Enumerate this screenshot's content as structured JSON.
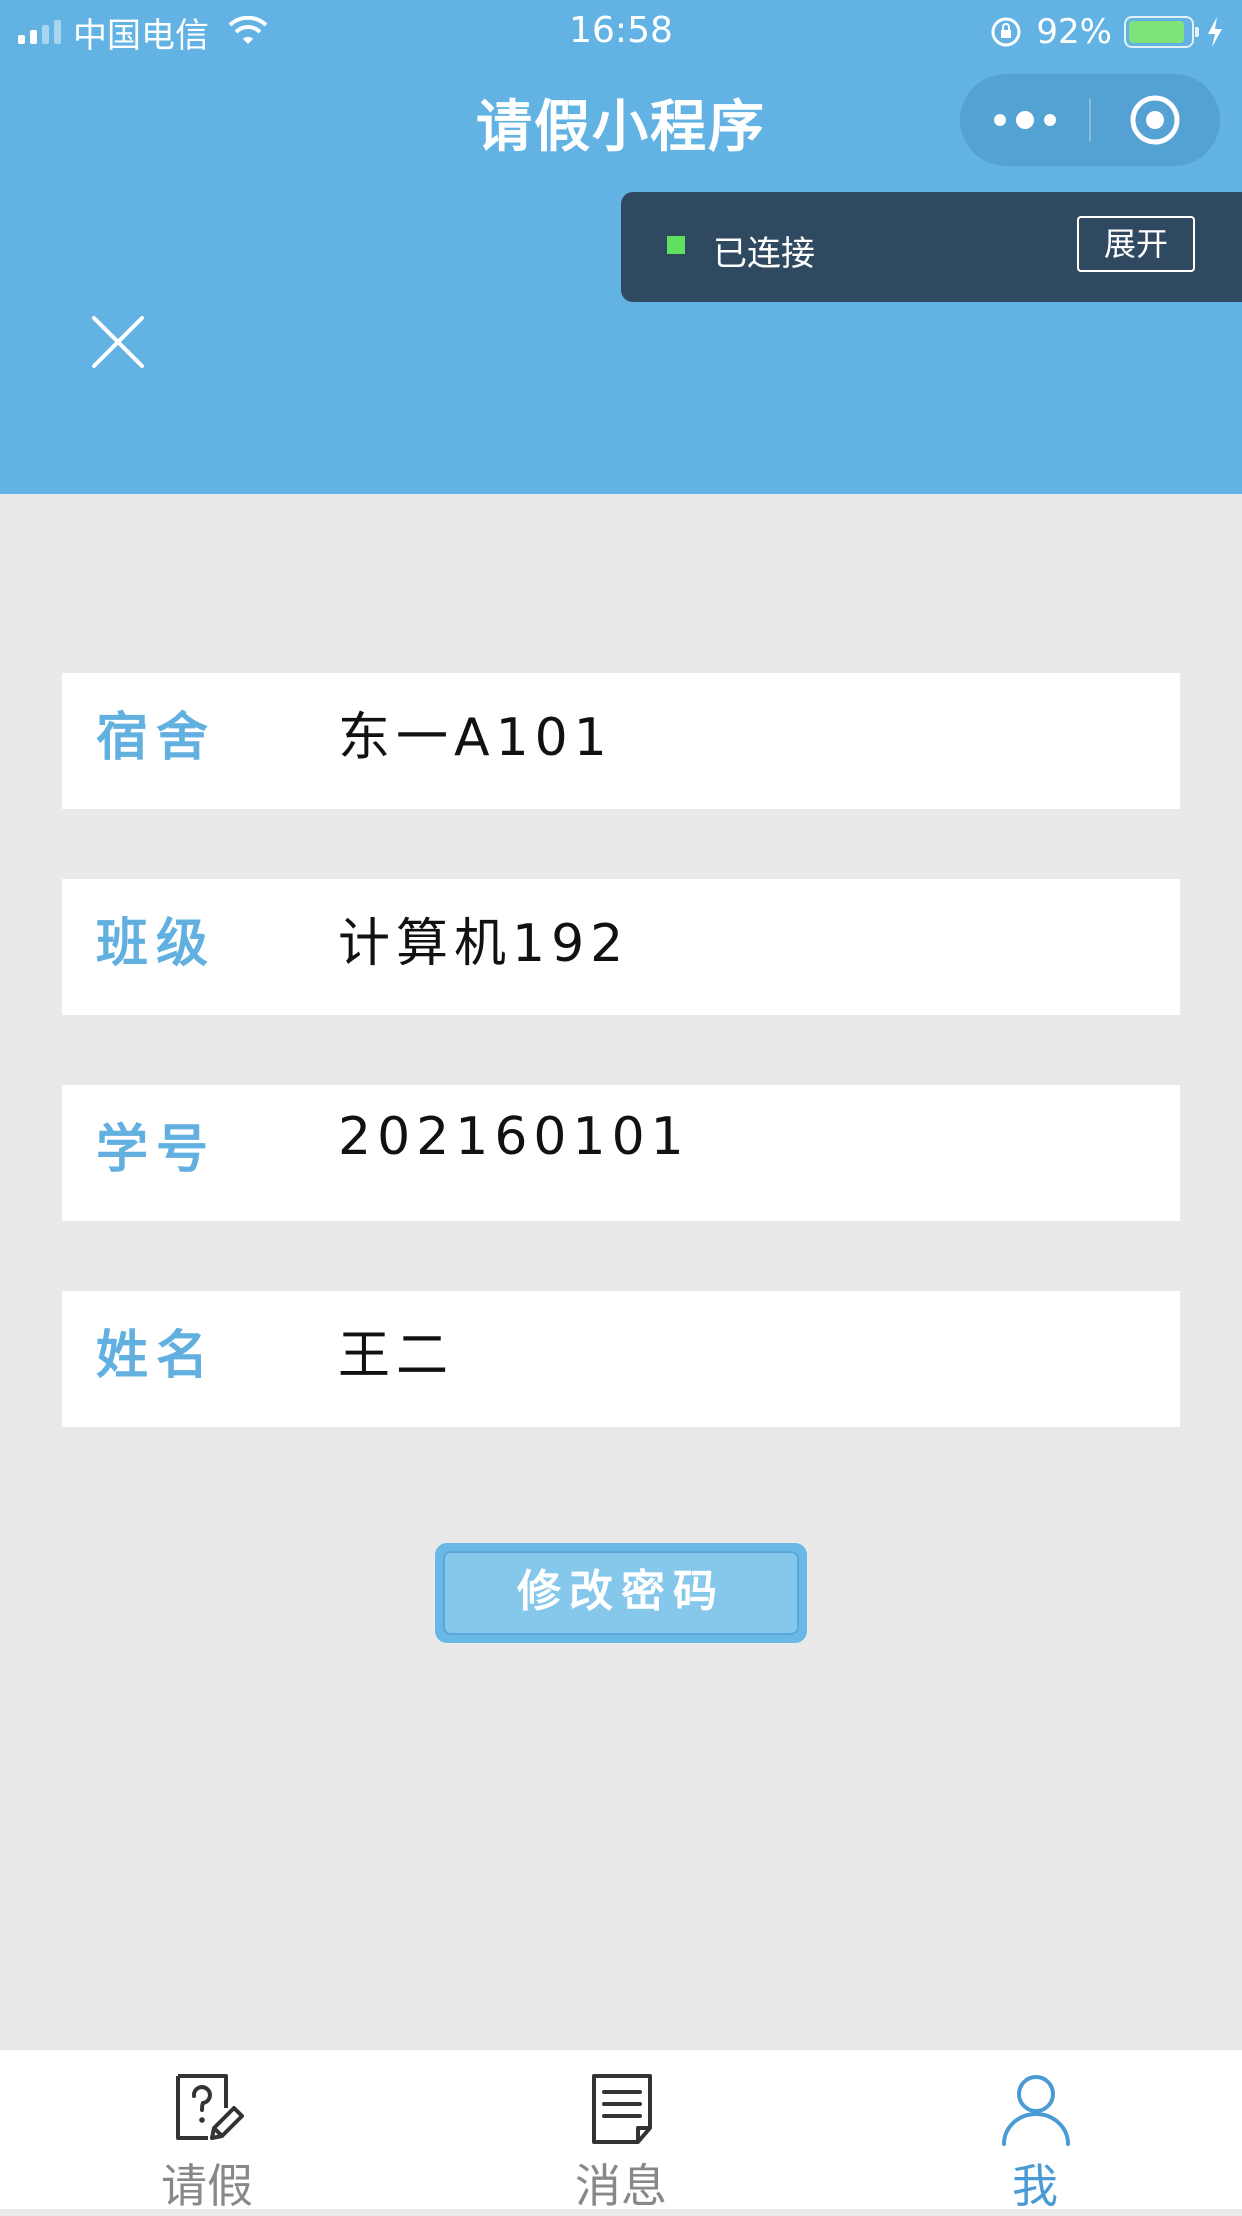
{
  "status_bar": {
    "carrier": "中国电信",
    "time": "16:58",
    "battery_percent": "92%",
    "battery_level": 0.92
  },
  "nav": {
    "title": "请假小程序"
  },
  "debug": {
    "status": "已连接",
    "expand_label": "展开"
  },
  "profile": {
    "fields": [
      {
        "label": "宿舍",
        "value": "东一A101"
      },
      {
        "label": "班级",
        "value": "计算机192"
      },
      {
        "label": "学号",
        "value": "202160101"
      },
      {
        "label": "姓名",
        "value": "王二"
      }
    ],
    "change_password_label": "修改密码"
  },
  "tabbar": {
    "items": [
      {
        "label": "请假",
        "icon": "leave-request-icon",
        "active": false
      },
      {
        "label": "消息",
        "icon": "message-document-icon",
        "active": false
      },
      {
        "label": "我",
        "icon": "user-profile-icon",
        "active": true
      }
    ]
  },
  "colors": {
    "header": "#62b3e4",
    "accent": "#62b0e0",
    "active_tab": "#4a9ad4",
    "background": "#e9e9e9",
    "debug_bar": "#2f4a60"
  }
}
